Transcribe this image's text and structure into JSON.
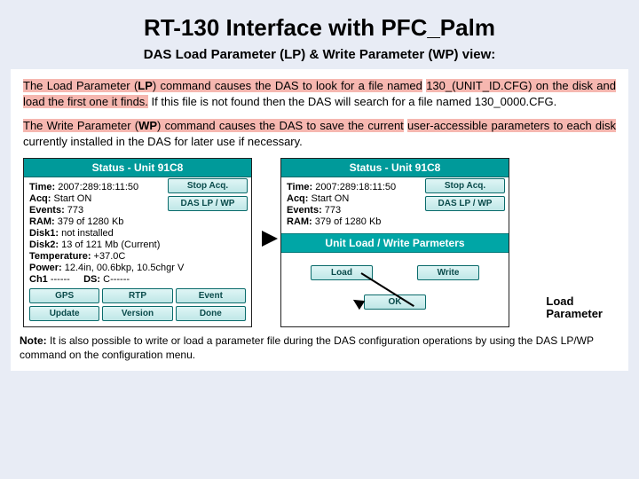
{
  "title": "RT-130 Interface with PFC_Palm",
  "subtitle": "DAS Load Parameter (LP) & Write Parameter (WP) view:",
  "para1": {
    "h1": "The Load Parameter (",
    "h1b": "LP",
    "h1c": ") command causes the DAS to look for a file named",
    "h2": "130_(UNIT_ID.CFG) on the disk and load the first one it finds.",
    "rest": " If this file is not found then the DAS will search for a file named 130_0000.CFG."
  },
  "para2": {
    "h1": "The Write Parameter (",
    "h1b": "WP",
    "h1c": ") command causes the DAS to save the current",
    "h2": "user-accessible parameters to each disk",
    "rest": " currently installed in the DAS for later use if necessary."
  },
  "left": {
    "titlebar": "Status - Unit 91C8",
    "time_k": "Time:",
    "time_v": " 2007:289:18:11:50",
    "acq_k": "Acq:",
    "acq_v": " Start ON",
    "events_k": "Events:",
    "events_v": " 773",
    "ram_k": "RAM:",
    "ram_v": " 379 of 1280 Kb",
    "disk1_k": "Disk1:",
    "disk1_v": " not installed",
    "disk2_k": "Disk2:",
    "disk2_v": " 13 of 121 Mb (Current)",
    "temp_k": "Temperature:",
    "temp_v": " +37.0C",
    "power_k": "Power:",
    "power_v": " 12.4in, 00.6bkp, 10.5chgr V",
    "ch_k": "Ch1",
    "ch_v": " ------",
    "ds_k": "DS:",
    "ds_v": " C------",
    "btn_stop": "Stop Acq.",
    "btn_lpwp": "DAS LP / WP",
    "b1": "GPS",
    "b2": "RTP",
    "b3": "Event",
    "b4": "Update",
    "b5": "Version",
    "b6": "Done"
  },
  "right": {
    "titlebar": "Status - Unit 91C8",
    "time_k": "Time:",
    "time_v": " 2007:289:18:11:50",
    "acq_k": "Acq:",
    "acq_v": " Start ON",
    "events_k": "Events:",
    "events_v": " 773",
    "ram_k": "RAM:",
    "ram_v": " 379 of 1280 Kb",
    "btn_stop": "Stop Acq.",
    "btn_lpwp": "DAS LP / WP",
    "secbar": "Unit Load / Write Parmeters",
    "btn_load": "Load",
    "btn_write": "Write",
    "btn_ok": "OK"
  },
  "lp_label_l1": "Load",
  "lp_label_l2": "Parameter",
  "footnote_nb": "Note:",
  "footnote_body": " It is also possible to write or load a parameter file during the DAS configuration operations by using the DAS LP/WP command on the configuration menu."
}
